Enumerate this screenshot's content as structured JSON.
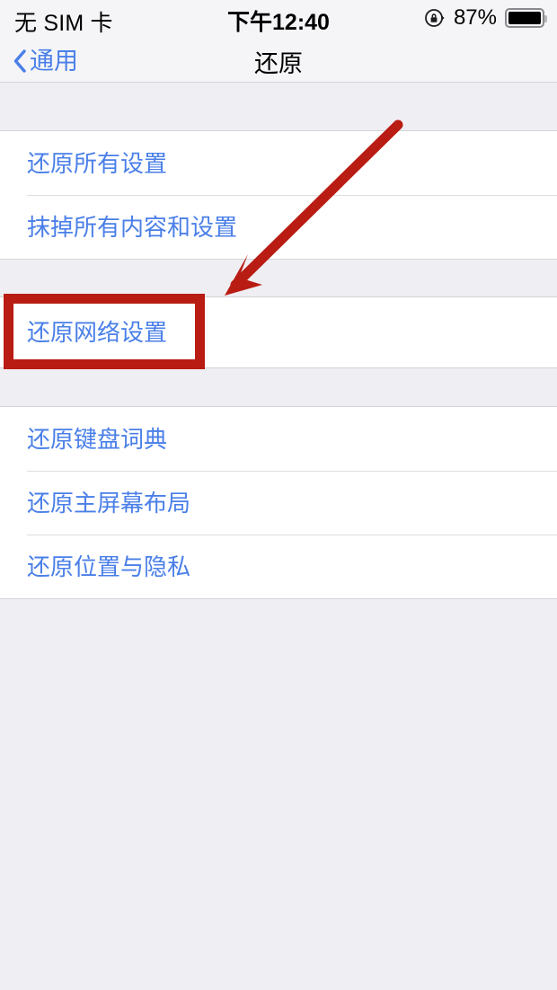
{
  "status_bar": {
    "carrier": "无 SIM 卡",
    "time": "下午12:40",
    "battery_percent": "87%",
    "rotation_lock_icon": "rotation-lock-icon",
    "battery_icon": "battery-full-icon"
  },
  "nav_bar": {
    "back_label": "通用",
    "back_icon": "chevron-left-icon",
    "title": "还原"
  },
  "groups": [
    {
      "rows": [
        {
          "label": "还原所有设置"
        },
        {
          "label": "抹掉所有内容和设置"
        }
      ]
    },
    {
      "rows": [
        {
          "label": "还原网络设置",
          "highlighted": true
        }
      ]
    },
    {
      "rows": [
        {
          "label": "还原键盘词典"
        },
        {
          "label": "还原主屏幕布局"
        },
        {
          "label": "还原位置与隐私"
        }
      ]
    }
  ],
  "annotations": {
    "highlight_color": "#B81C12",
    "arrow_color": "#B81C12",
    "highlight_target": "还原网络设置",
    "arrow_from": "445,140",
    "arrow_to": "250,328"
  },
  "colors": {
    "link_blue": "#4A7FE8",
    "page_background": "#EFEEF3",
    "row_background": "#FFFFFF",
    "bar_background": "#F5F5F7",
    "separator": "#D3D3D8"
  }
}
